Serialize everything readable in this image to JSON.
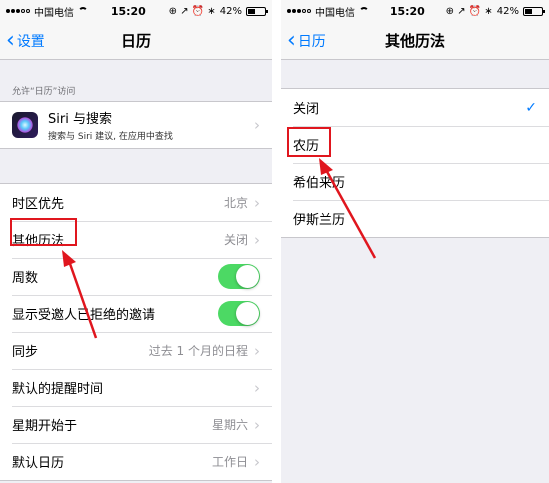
{
  "status_bar": {
    "carrier": "中国电信",
    "time": "15:20",
    "battery": "42%",
    "battery_level": 0.42
  },
  "left_screen": {
    "back_label": "设置",
    "title": "日历",
    "section_header": "允许“日历”访问",
    "siri": {
      "title": "Siri 与搜索",
      "subtitle": "搜索与 Siri 建议, 在应用中查找"
    },
    "settings": [
      {
        "label": "时区优先",
        "value": "北京",
        "type": "chevron"
      },
      {
        "label": "其他历法",
        "value": "关闭",
        "type": "chevron"
      },
      {
        "label": "周数",
        "value": "",
        "type": "toggle",
        "on": true
      },
      {
        "label": "显示受邀人已拒绝的邀请",
        "value": "",
        "type": "toggle",
        "on": true
      },
      {
        "label": "同步",
        "value": "过去 1 个月的日程",
        "type": "chevron"
      },
      {
        "label": "默认的提醒时间",
        "value": "",
        "type": "chevron"
      },
      {
        "label": "星期开始于",
        "value": "星期六",
        "type": "chevron"
      },
      {
        "label": "默认日历",
        "value": "工作日",
        "type": "chevron"
      }
    ]
  },
  "right_screen": {
    "back_label": "日历",
    "title": "其他历法",
    "options": [
      {
        "label": "关闭",
        "selected": true
      },
      {
        "label": "农历",
        "selected": false
      },
      {
        "label": "希伯来历",
        "selected": false
      },
      {
        "label": "伊斯兰历",
        "selected": false
      }
    ]
  },
  "colors": {
    "accent": "#007aff",
    "toggle_on": "#4cd964",
    "annotation": "#e0161e"
  }
}
